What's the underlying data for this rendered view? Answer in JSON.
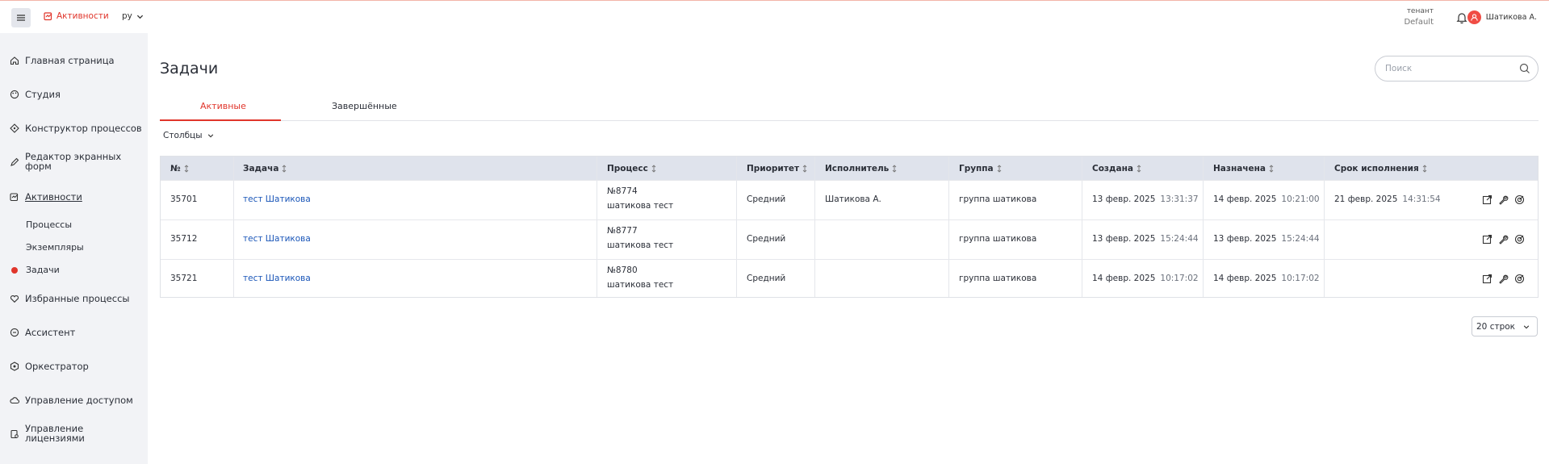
{
  "header": {
    "app_label": "Активности",
    "language": "ру",
    "tenant_caption": "тенант",
    "tenant_value": "Default",
    "user_name": "Шатикова А."
  },
  "sidebar": {
    "items": [
      {
        "label": "Главная страница",
        "icon": "home-icon"
      },
      {
        "label": "Студия",
        "icon": "palette-icon"
      },
      {
        "label": "Конструктор процессов",
        "icon": "process-icon"
      },
      {
        "label": "Редактор экранных форм",
        "icon": "pen-icon"
      },
      {
        "label": "Активности",
        "icon": "activity-icon"
      },
      {
        "label": "Избранные процессы",
        "icon": "heart-icon"
      },
      {
        "label": "Ассистент",
        "icon": "chat-icon"
      },
      {
        "label": "Оркестратор",
        "icon": "orchestrator-icon"
      },
      {
        "label": "Управление доступом",
        "icon": "cloud-lock-icon"
      },
      {
        "label": "Управление лицензиями",
        "icon": "license-icon"
      }
    ],
    "sub_items": [
      "Процессы",
      "Экземпляры",
      "Задачи"
    ]
  },
  "main": {
    "title": "Задачи",
    "search_placeholder": "Поиск",
    "tabs": [
      "Активные",
      "Завершённые"
    ],
    "columns_button": "Столбцы",
    "table": {
      "headers": [
        "№",
        "Задача",
        "Процесс",
        "Приоритет",
        "Исполнитель",
        "Группа",
        "Создана",
        "Назначена",
        "Срок исполнения"
      ],
      "rows": [
        {
          "id": "35701",
          "task": "тест Шатикова",
          "process_no": "№8774",
          "process_name": "шатикова тест",
          "priority": "Средний",
          "assignee": "Шатикова А.",
          "group": "группа шатикова",
          "created_date": "13 февр. 2025",
          "created_time": "13:31:37",
          "assigned_date": "14 февр. 2025",
          "assigned_time": "10:21:00",
          "due_date": "21 февр. 2025",
          "due_time": "14:31:54"
        },
        {
          "id": "35712",
          "task": "тест Шатикова",
          "process_no": "№8777",
          "process_name": "шатикова тест",
          "priority": "Средний",
          "assignee": "",
          "group": "группа шатикова",
          "created_date": "13 февр. 2025",
          "created_time": "15:24:44",
          "assigned_date": "13 февр. 2025",
          "assigned_time": "15:24:44",
          "due_date": "",
          "due_time": ""
        },
        {
          "id": "35721",
          "task": "тест Шатикова",
          "process_no": "№8780",
          "process_name": "шатикова тест",
          "priority": "Средний",
          "assignee": "",
          "group": "группа шатикова",
          "created_date": "14 февр. 2025",
          "created_time": "10:17:02",
          "assigned_date": "14 февр. 2025",
          "assigned_time": "10:17:02",
          "due_date": "",
          "due_time": ""
        }
      ]
    },
    "rows_per_page": "20 строк"
  },
  "colors": {
    "accent": "#e0352b",
    "link": "#1a56b8",
    "sidebar_bg": "#f2f3f6",
    "table_header_bg": "#dfe3ec"
  }
}
